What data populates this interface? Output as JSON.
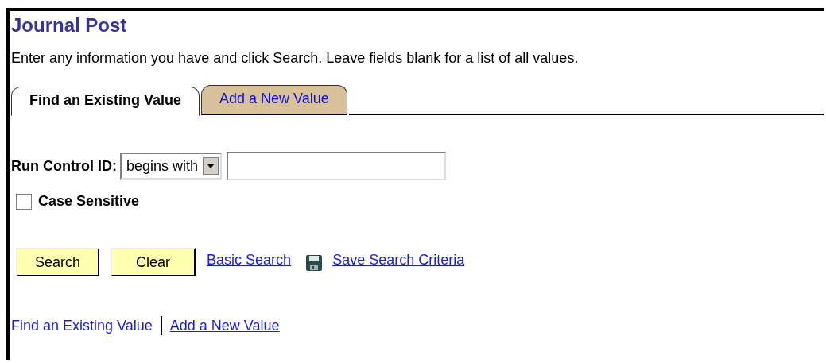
{
  "page": {
    "title": "Journal Post",
    "instructions": "Enter any information you have and click Search. Leave fields blank for a list of all values."
  },
  "tabs": [
    {
      "label": "Find an Existing Value",
      "selected": true
    },
    {
      "label": "Add a New Value",
      "selected": false
    }
  ],
  "search": {
    "field_label": "Run Control ID:",
    "operator": "begins with"
  },
  "case_sensitive": {
    "label": "Case Sensitive",
    "checked": false
  },
  "buttons": [
    "Search",
    "Clear"
  ],
  "links": [
    {
      "label": "Basic Search",
      "kind": "plain"
    },
    {
      "label": "Save Search Criteria",
      "kind": "save"
    }
  ],
  "footer_links": [
    {
      "label": "Find an Existing Value",
      "selected": true
    },
    {
      "label": "Add a New Value",
      "selected": false
    }
  ]
}
